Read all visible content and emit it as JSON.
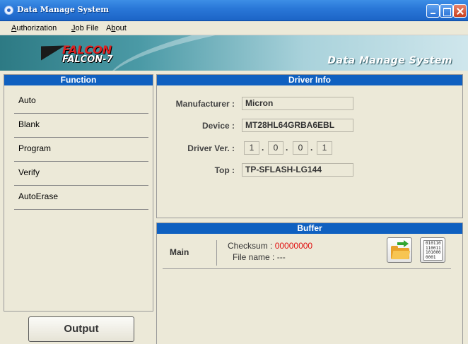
{
  "window": {
    "title": "Data Manage System"
  },
  "menu": {
    "items": [
      {
        "label": "Authorization",
        "underline": "A",
        "rest": "uthorization"
      },
      {
        "label": "Job File",
        "underline": "J",
        "rest": "ob File"
      },
      {
        "label": "About",
        "underline": "b",
        "pre": "A",
        "rest": "out"
      }
    ]
  },
  "banner": {
    "logo_brand": "FALCON",
    "logo_model": "FALCON-7",
    "system_title": "Data Manage System"
  },
  "function_panel": {
    "header": "Function",
    "items": [
      "Auto",
      "Blank",
      "Program",
      "Verify",
      "AutoErase"
    ]
  },
  "output_button": {
    "label": "Output"
  },
  "driver_info": {
    "header": "Driver Info",
    "manufacturer_label": "Manufacturer :",
    "manufacturer_value": "Micron",
    "device_label": "Device :",
    "device_value": "MT28HL64GRBA6EBL",
    "driver_ver_label": "Driver Ver. :",
    "driver_ver_parts": [
      "1",
      "0",
      "0",
      "1"
    ],
    "top_label": "Top :",
    "top_value": "TP-SFLASH-LG144"
  },
  "buffer": {
    "header": "Buffer",
    "main_label": "Main",
    "checksum_label": "Checksum :",
    "checksum_value": "00000000",
    "filename_label": "File name :",
    "filename_value": "---",
    "binary_icon_text": "010110 110011 101000 0001"
  },
  "colors": {
    "panel_header": "#0f60c0",
    "checksum": "#e01010",
    "background": "#ece9d8"
  }
}
